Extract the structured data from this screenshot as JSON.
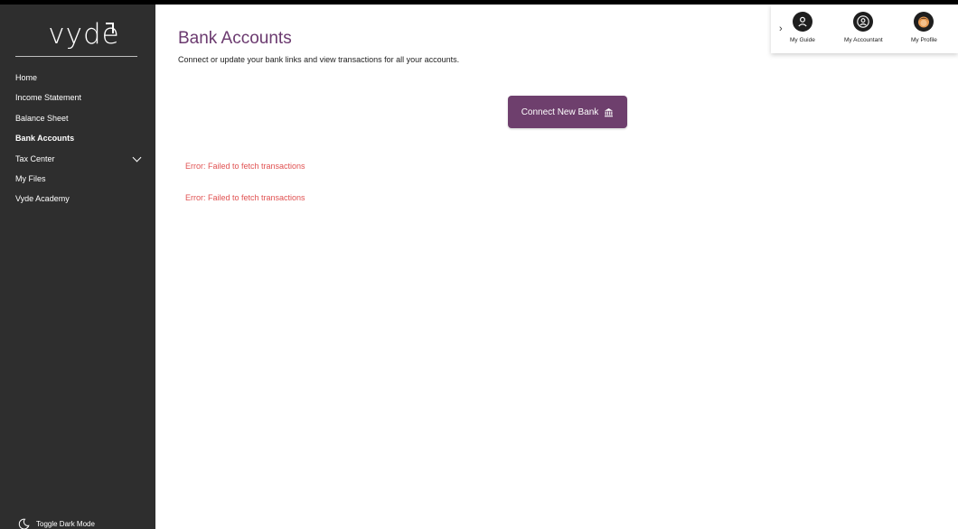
{
  "brand": {
    "logo_text": "vyde"
  },
  "sidebar": {
    "items": [
      {
        "label": "Home"
      },
      {
        "label": "Income Statement"
      },
      {
        "label": "Balance Sheet"
      },
      {
        "label": "Bank Accounts"
      },
      {
        "label": "Tax Center"
      },
      {
        "label": "My Files"
      },
      {
        "label": "Vyde Academy"
      }
    ],
    "active_item": "Bank Accounts",
    "toggle_dark_mode": "Toggle Dark Mode"
  },
  "main": {
    "title": "Bank Accounts",
    "subtitle": "Connect or update your bank links and view transactions for all your accounts.",
    "connect_button": "Connect New Bank",
    "errors": [
      "Error: Failed to fetch transactions",
      "Error: Failed to fetch transactions"
    ]
  },
  "top_panel": {
    "arrow": "›",
    "items": [
      {
        "label": "My Guide",
        "icon": "person-icon"
      },
      {
        "label": "My Accountant",
        "icon": "accountant-icon"
      },
      {
        "label": "My Profile",
        "icon": "avatar-icon"
      }
    ]
  },
  "colors": {
    "sidebar_bg": "#2e2e2e",
    "accent": "#6e3f6d",
    "title": "#6b3a6f",
    "error": "#e05151"
  }
}
